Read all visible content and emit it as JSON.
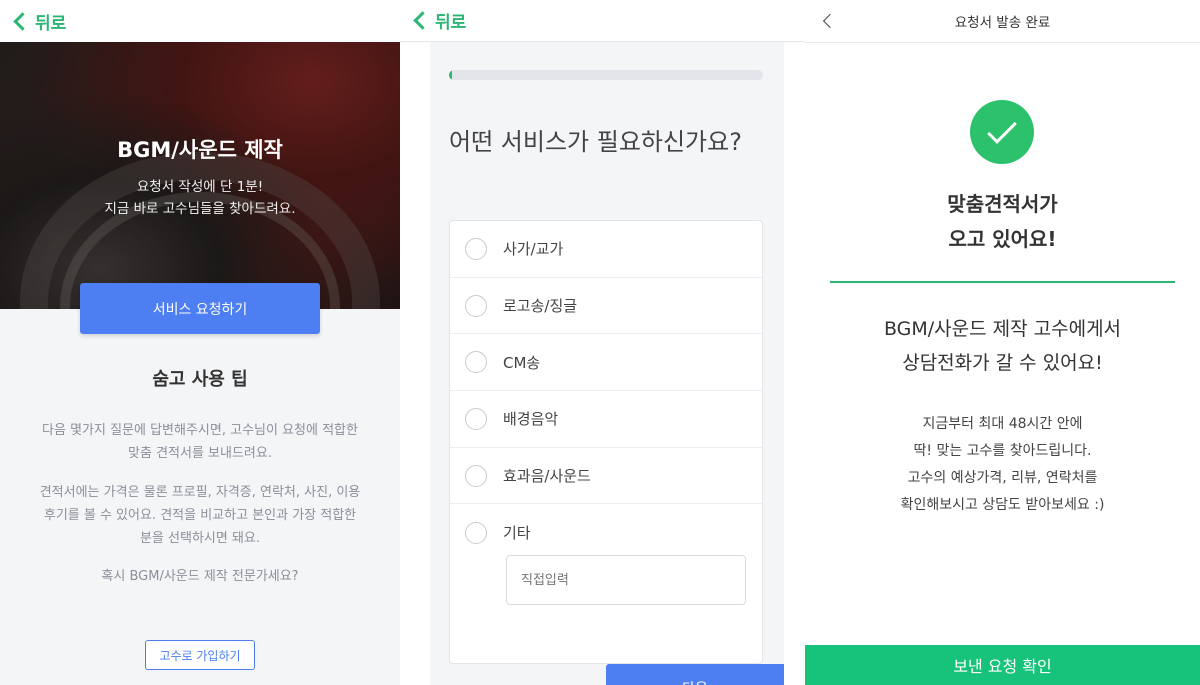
{
  "panel1": {
    "back_label": "뒤로",
    "hero": {
      "title": "BGM/사운드 제작",
      "sub_line1": "요청서 작성에 단 1분!",
      "sub_line2": "지금 바로 고수님들을 찾아드려요."
    },
    "request_button": "서비스 요청하기",
    "tips": {
      "title": "숨고 사용 팁",
      "para1_line1": "다음 몇가지 질문에 답변해주시면, 고수님이 요청에 적합한",
      "para1_line2": "맞춤 견적서를 보내드려요.",
      "para2_line1": "견적서에는 가격은 물론 프로필, 자격증, 연락처, 사진, 이용",
      "para2_line2": "후기를 볼 수 있어요. 견적을 비교하고 본인과 가장 적합한",
      "para2_line3": "분을 선택하시면 돼요.",
      "question": "혹시 BGM/사운드 제작 전문가세요?",
      "join_button": "고수로 가입하기"
    }
  },
  "panel2": {
    "back_label": "뒤로",
    "progress_percent": 1,
    "question": "어떤 서비스가 필요하신가요?",
    "options": [
      {
        "label": "사가/교가"
      },
      {
        "label": "로고송/징글"
      },
      {
        "label": "CM송"
      },
      {
        "label": "배경음악"
      },
      {
        "label": "효과음/사운드"
      },
      {
        "label": "기타"
      }
    ],
    "direct_input_placeholder": "직접입력",
    "next_button": "다음"
  },
  "panel3": {
    "title": "요청서 발송 완료",
    "done_line1": "맞춤견적서가",
    "done_line2": "오고 있어요!",
    "msg_line1": "BGM/사운드 제작 고수에게서",
    "msg_line2": "상담전화가 갈 수 있어요!",
    "info_line1": "지금부터 최대 48시간 안에",
    "info_line2": "딱! 맞는 고수를 찾아드립니다.",
    "info_line3": "고수의 예상가격, 리뷰, 연락처를",
    "info_line4": "확인해보시고 상담도 받아보세요 :)",
    "confirm_button": "보낸 요청 확인"
  },
  "colors": {
    "green": "#2bb673",
    "blue": "#4d7ef2",
    "confirm_green": "#17c27b"
  }
}
